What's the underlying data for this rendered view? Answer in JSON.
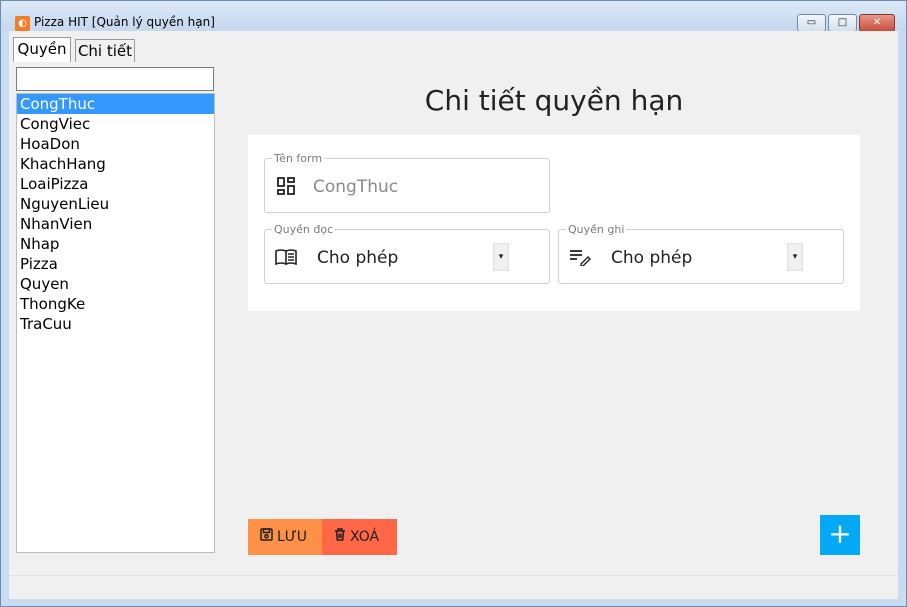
{
  "window": {
    "title": "Pizza HIT [Quản lý quyền hạn]",
    "controls": {
      "minimize": "▭",
      "maximize": "□",
      "close": "✕"
    }
  },
  "tabs": [
    {
      "label": "Quyền",
      "active": true
    },
    {
      "label": "Chi tiết",
      "active": false
    }
  ],
  "search": {
    "value": "",
    "placeholder": ""
  },
  "list": {
    "items": [
      "CongThuc",
      "CongViec",
      "HoaDon",
      "KhachHang",
      "LoaiPizza",
      "NguyenLieu",
      "NhanVien",
      "Nhap",
      "Pizza",
      "Quyen",
      "ThongKe",
      "TraCuu"
    ],
    "selected": "CongThuc"
  },
  "detail": {
    "heading": "Chi tiết quyền hạn",
    "ten_form": {
      "label": "Tên form",
      "value": "CongThuc",
      "icon": "dashboard-icon"
    },
    "quyen_doc": {
      "label": "Quyền đọc",
      "value": "Cho phép",
      "icon": "book-icon"
    },
    "quyen_ghi": {
      "label": "Quyền ghi",
      "value": "Cho phép",
      "icon": "edit-note-icon"
    }
  },
  "actions": {
    "save_label": "LƯU",
    "delete_label": "XOÁ",
    "add_label": "+"
  },
  "colors": {
    "accent": "#3399ff",
    "save": "#ff9048",
    "delete": "#ff6746",
    "add": "#03a9f4"
  }
}
